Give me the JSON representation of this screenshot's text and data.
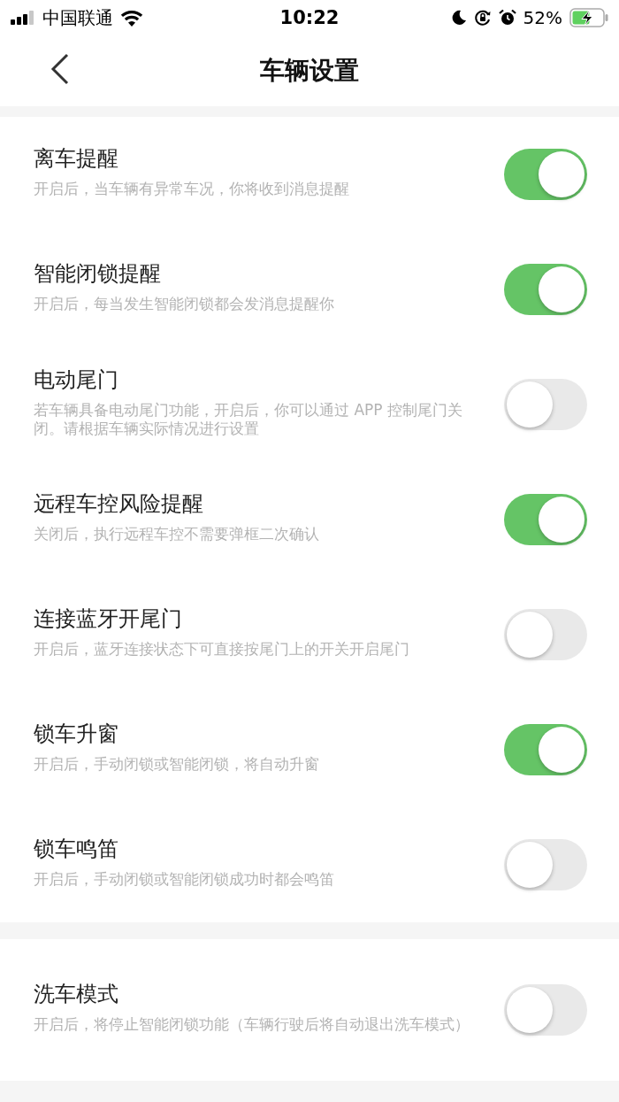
{
  "status_bar": {
    "carrier": "中国联通",
    "time": "10:22",
    "battery": "52%"
  },
  "nav": {
    "title": "车辆设置"
  },
  "sections": [
    {
      "items": [
        {
          "title": "离车提醒",
          "description": "开启后，当车辆有异常车况，你将收到消息提醒",
          "on": true
        },
        {
          "title": "智能闭锁提醒",
          "description": "开启后，每当发生智能闭锁都会发消息提醒你",
          "on": true
        },
        {
          "title": "电动尾门",
          "description": "若车辆具备电动尾门功能，开启后，你可以通过 APP 控制尾门关闭。请根据车辆实际情况进行设置",
          "on": false
        },
        {
          "title": "远程车控风险提醒",
          "description": "关闭后，执行远程车控不需要弹框二次确认",
          "on": true
        },
        {
          "title": "连接蓝牙开尾门",
          "description": "开启后，蓝牙连接状态下可直接按尾门上的开关开启尾门",
          "on": false
        },
        {
          "title": "锁车升窗",
          "description": "开启后，手动闭锁或智能闭锁，将自动升窗",
          "on": true
        },
        {
          "title": "锁车鸣笛",
          "description": "开启后，手动闭锁或智能闭锁成功时都会鸣笛",
          "on": false
        }
      ]
    },
    {
      "items": [
        {
          "title": "洗车模式",
          "description": "开启后，将停止智能闭锁功能（车辆行驶后将自动退出洗车模式）",
          "on": false
        }
      ]
    }
  ]
}
